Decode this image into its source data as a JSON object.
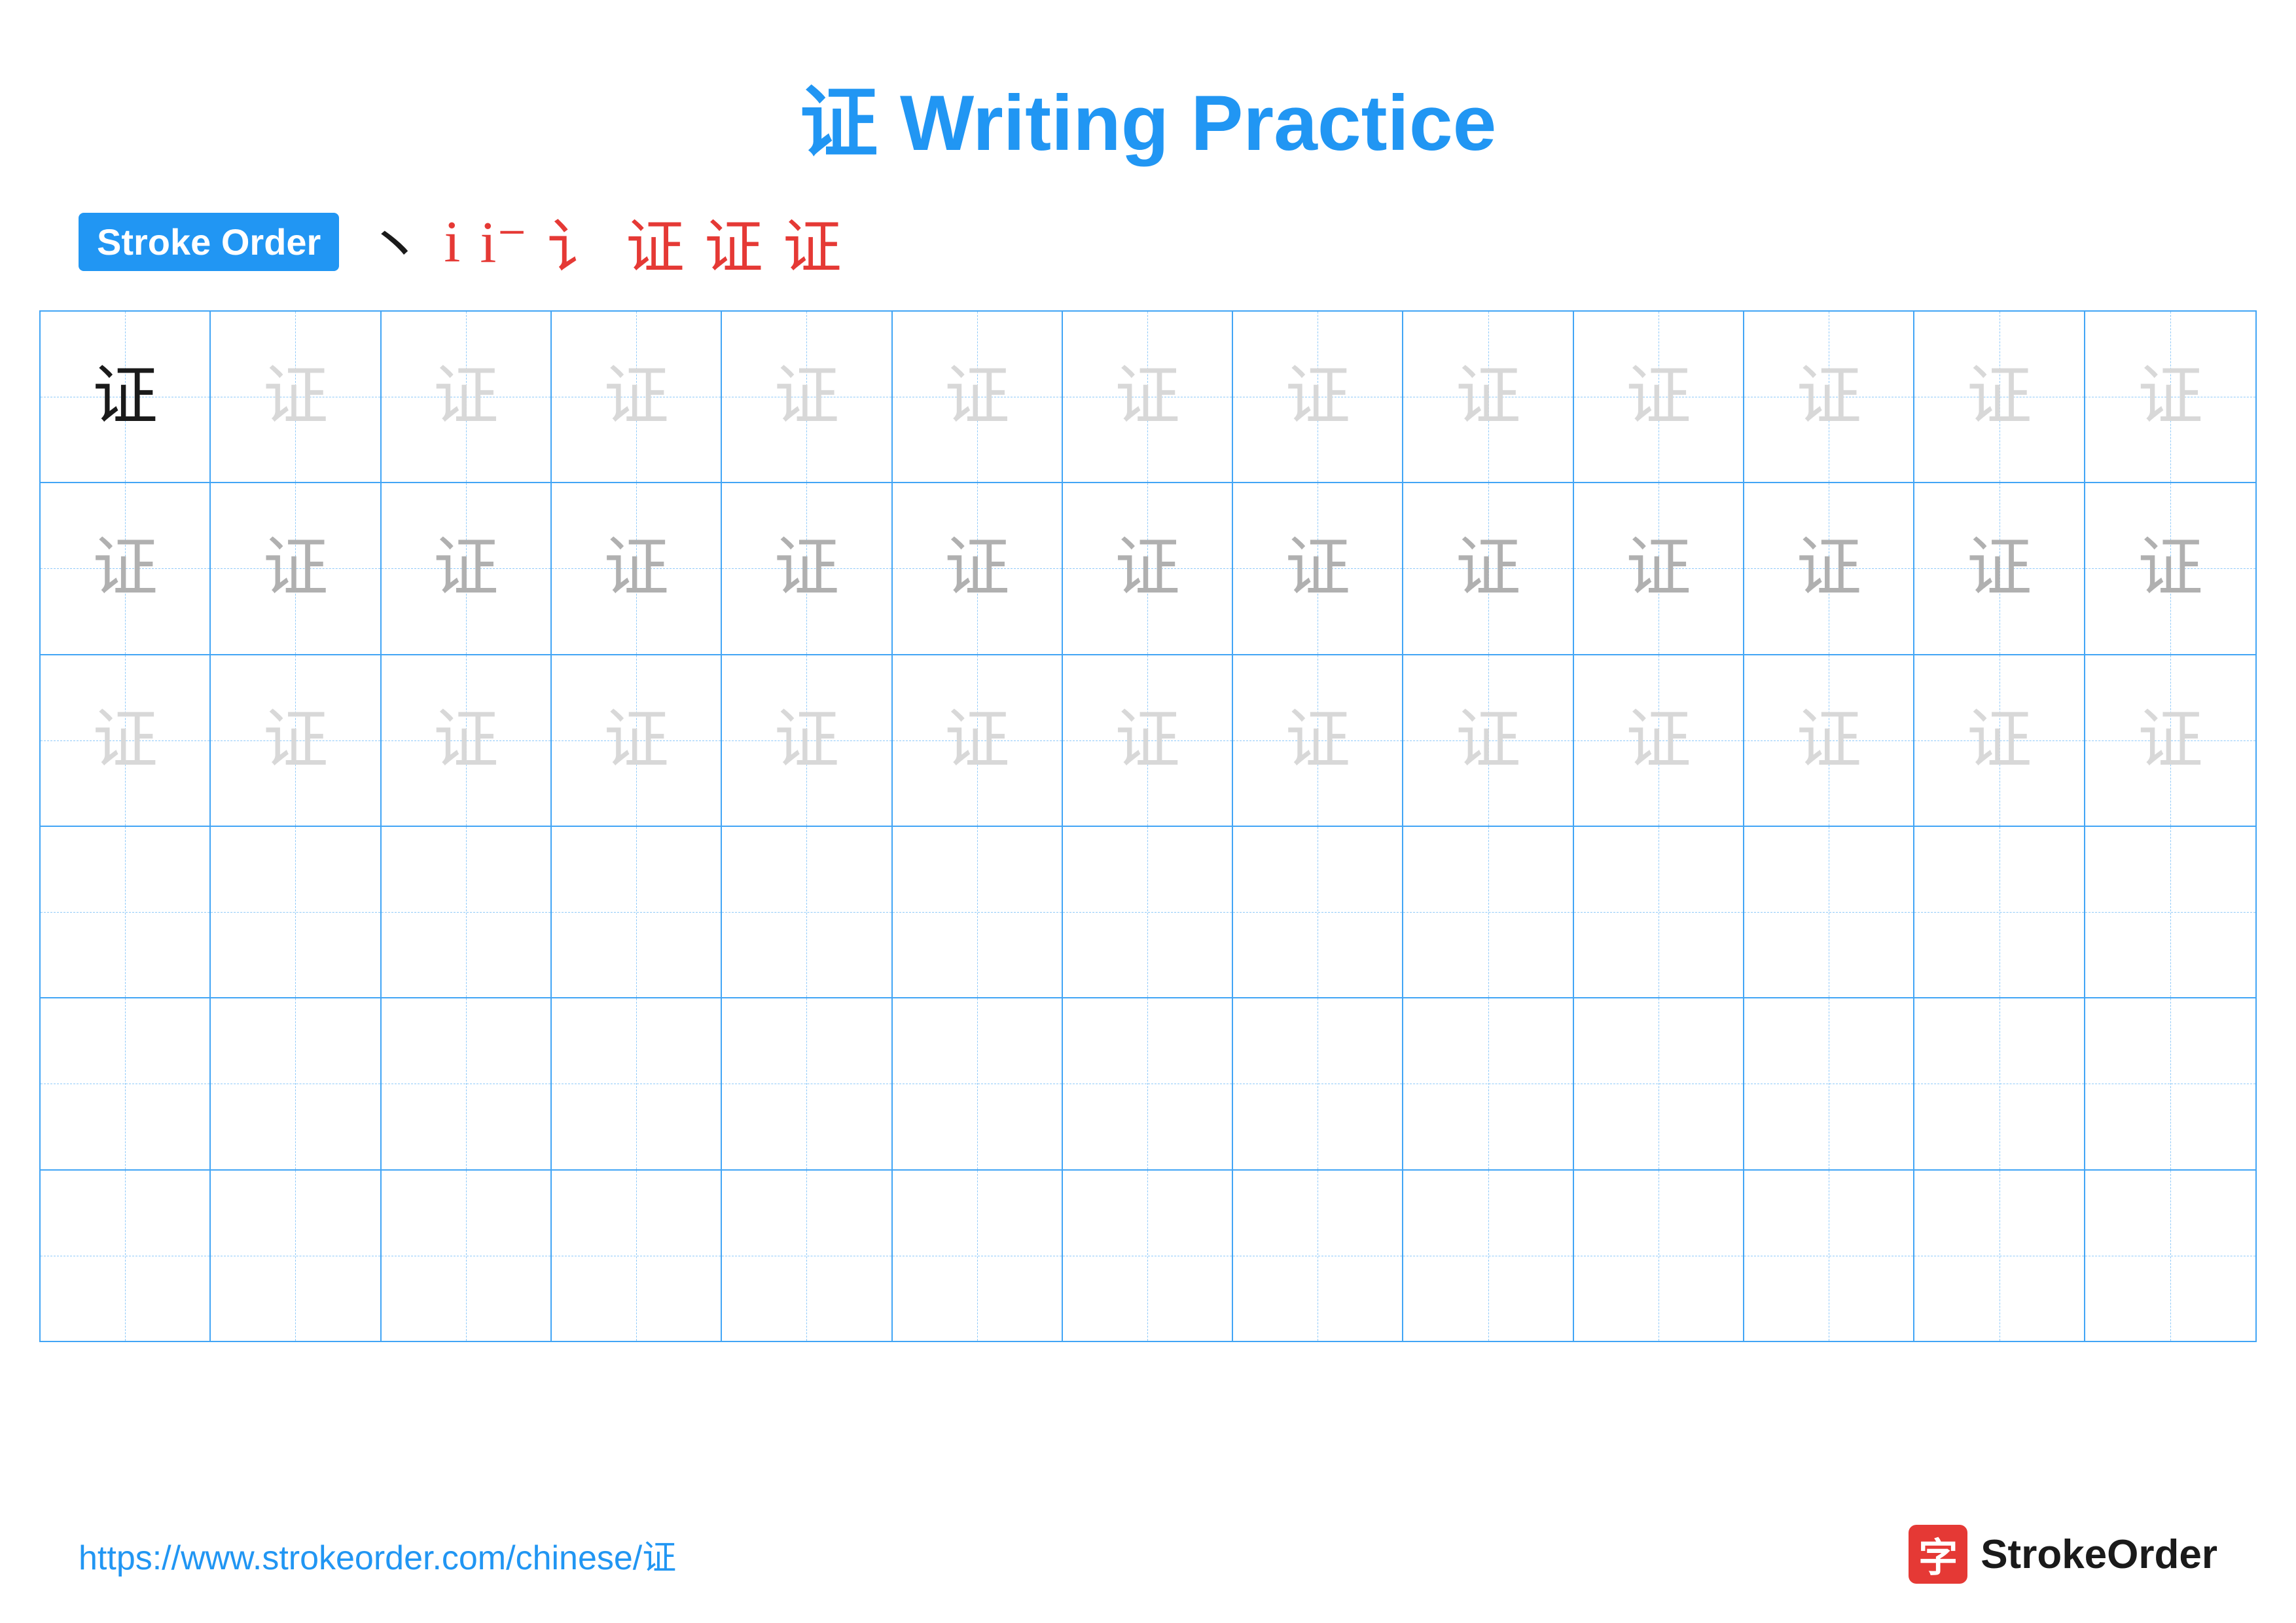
{
  "title": "证 Writing Practice",
  "title_char": "证",
  "title_text": " Writing Practice",
  "stroke_order_label": "Stroke Order",
  "stroke_sequence": [
    "丶",
    "i",
    "i⁻",
    "讠",
    "讠⁺",
    "证",
    "证"
  ],
  "character": "证",
  "grid": {
    "rows": 6,
    "cols": 13,
    "row_data": [
      {
        "chars": [
          "证",
          "证",
          "证",
          "证",
          "证",
          "证",
          "证",
          "证",
          "证",
          "证",
          "证",
          "证",
          "证"
        ],
        "styles": [
          "dark",
          "light",
          "light",
          "light",
          "light",
          "light",
          "light",
          "light",
          "light",
          "light",
          "light",
          "light",
          "light"
        ]
      },
      {
        "chars": [
          "证",
          "证",
          "证",
          "证",
          "证",
          "证",
          "证",
          "证",
          "证",
          "证",
          "证",
          "证",
          "证"
        ],
        "styles": [
          "medium",
          "medium",
          "medium",
          "medium",
          "medium",
          "medium",
          "medium",
          "medium",
          "medium",
          "medium",
          "medium",
          "medium",
          "medium"
        ]
      },
      {
        "chars": [
          "证",
          "证",
          "证",
          "证",
          "证",
          "证",
          "证",
          "证",
          "证",
          "证",
          "证",
          "证",
          "证"
        ],
        "styles": [
          "light",
          "light",
          "light",
          "light",
          "light",
          "light",
          "light",
          "light",
          "light",
          "light",
          "light",
          "light",
          "light"
        ]
      },
      {
        "chars": [
          "",
          "",
          "",
          "",
          "",
          "",
          "",
          "",
          "",
          "",
          "",
          "",
          ""
        ],
        "styles": [
          "",
          "",
          "",
          "",
          "",
          "",
          "",
          "",
          "",
          "",
          "",
          "",
          ""
        ]
      },
      {
        "chars": [
          "",
          "",
          "",
          "",
          "",
          "",
          "",
          "",
          "",
          "",
          "",
          "",
          ""
        ],
        "styles": [
          "",
          "",
          "",
          "",
          "",
          "",
          "",
          "",
          "",
          "",
          "",
          "",
          ""
        ]
      },
      {
        "chars": [
          "",
          "",
          "",
          "",
          "",
          "",
          "",
          "",
          "",
          "",
          "",
          "",
          ""
        ],
        "styles": [
          "",
          "",
          "",
          "",
          "",
          "",
          "",
          "",
          "",
          "",
          "",
          "",
          ""
        ]
      }
    ]
  },
  "footer": {
    "url": "https://www.strokeorder.com/chinese/证",
    "logo_text": "StrokeOrder",
    "logo_icon": "字"
  }
}
